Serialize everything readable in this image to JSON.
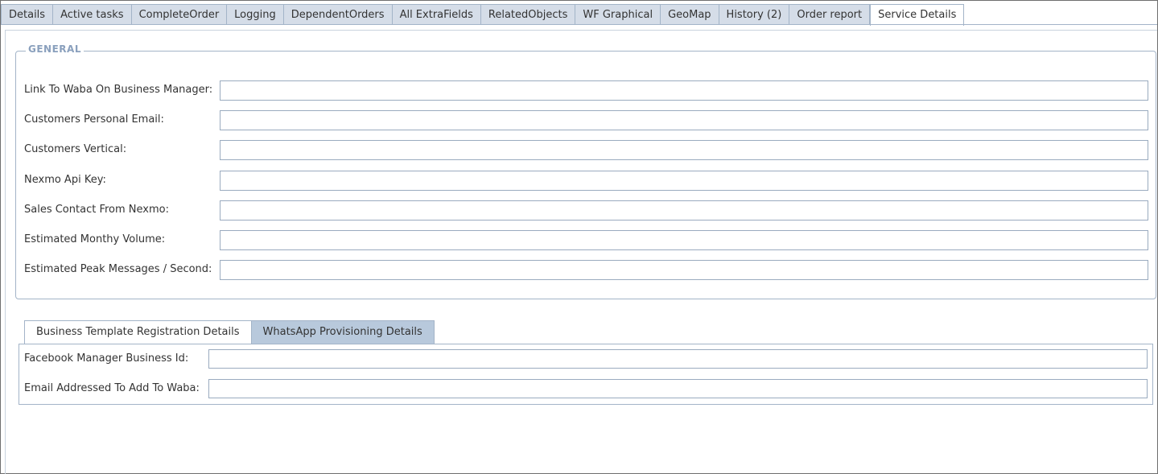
{
  "tabs": [
    {
      "label": "Details"
    },
    {
      "label": "Active tasks"
    },
    {
      "label": "CompleteOrder"
    },
    {
      "label": "Logging"
    },
    {
      "label": "DependentOrders"
    },
    {
      "label": "All ExtraFields"
    },
    {
      "label": "RelatedObjects"
    },
    {
      "label": "WF Graphical"
    },
    {
      "label": "GeoMap"
    },
    {
      "label": "History (2)"
    },
    {
      "label": "Order report"
    },
    {
      "label": "Service Details",
      "active": true
    }
  ],
  "general": {
    "legend": "GENERAL",
    "fields": [
      {
        "label": "Link To Waba On Business Manager:",
        "value": ""
      },
      {
        "label": "Customers Personal Email:",
        "value": ""
      },
      {
        "label": "Customers Vertical:",
        "value": ""
      },
      {
        "label": "Nexmo Api Key:",
        "value": ""
      },
      {
        "label": "Sales Contact From Nexmo:",
        "value": ""
      },
      {
        "label": "Estimated Monthy Volume:",
        "value": ""
      },
      {
        "label": "Estimated Peak Messages / Second:",
        "value": ""
      }
    ]
  },
  "sub_tabs": [
    {
      "label": "Business Template Registration Details",
      "active": true
    },
    {
      "label": "WhatsApp Provisioning Details",
      "active": false
    }
  ],
  "business_template": {
    "fields": [
      {
        "label": "Facebook Manager Business Id:",
        "value": ""
      },
      {
        "label": "Email Addressed To Add To Waba:",
        "value": ""
      }
    ]
  }
}
